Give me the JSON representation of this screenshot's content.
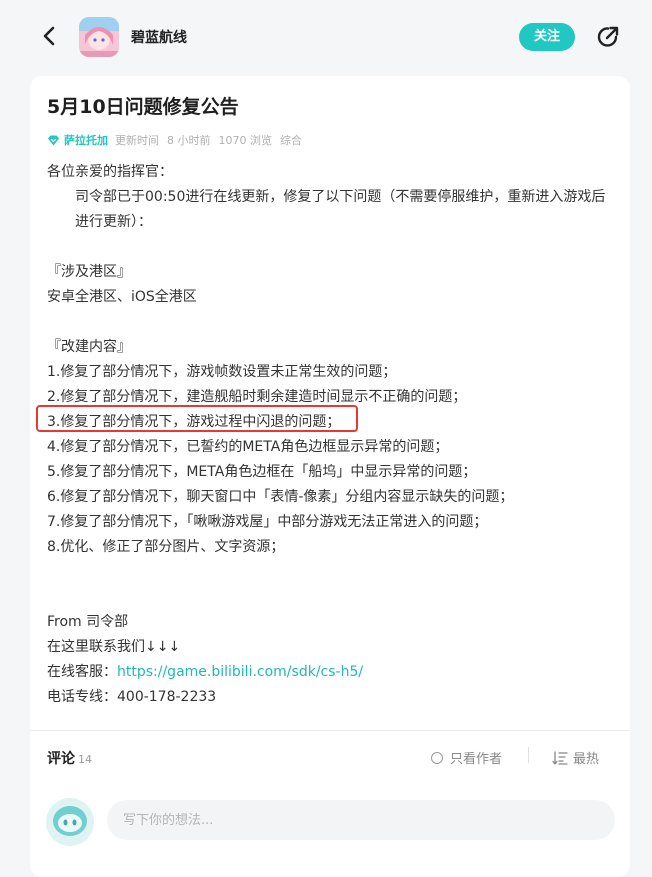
{
  "header": {
    "app_name": "碧蓝航线",
    "follow_label": "关注"
  },
  "post": {
    "title": "5月10日问题修复公告",
    "author": "萨拉托加",
    "updated_label": "更新时间",
    "updated_time": "8 小时前",
    "views": "1070 浏览",
    "category": "综合",
    "lines": {
      "greeting": "各位亲爱的指挥官：",
      "intro": "司令部已于00:50进行在线更新，修复了以下问题（不需要停服维护，重新进入游戏后进行更新）：",
      "region_heading": "『涉及港区』",
      "region": "安卓全港区、iOS全港区",
      "changes_heading": "『改建内容』",
      "item1": "1.修复了部分情况下，游戏帧数设置未正常生效的问题；",
      "item2": "2.修复了部分情况下，建造舰船时剩余建造时间显示不正确的问题；",
      "item3": "3.修复了部分情况下，游戏过程中闪退的问题；",
      "item4": "4.修复了部分情况下，已誓约的META角色边框显示异常的问题；",
      "item5": "5.修复了部分情况下，META角色边框在「船坞」中显示异常的问题；",
      "item6": "6.修复了部分情况下，聊天窗口中「表情-像素」分组内容显示缺失的问题；",
      "item7": "7.修复了部分情况下，「啾啾游戏屋」中部分游戏无法正常进入的问题；",
      "item8": "8.优化、修正了部分图片、文字资源；",
      "from": "From 司令部",
      "contact": "在这里联系我们↓↓↓",
      "service_label": "在线客服：",
      "service_link": "https://game.bilibili.com/sdk/cs-h5/",
      "phone": "电话专线：400-178-2233"
    }
  },
  "comments": {
    "label": "评论",
    "count": "14",
    "author_only_label": "只看作者",
    "sort_label": "最热",
    "input_placeholder": "写下你的想法..."
  },
  "colors": {
    "accent": "#21c7c2",
    "highlight_border": "#e53935"
  },
  "icons": {
    "back": "chevron-left-icon",
    "share": "share-icon",
    "author_badge": "diamond-badge-icon",
    "sort": "sort-icon"
  }
}
